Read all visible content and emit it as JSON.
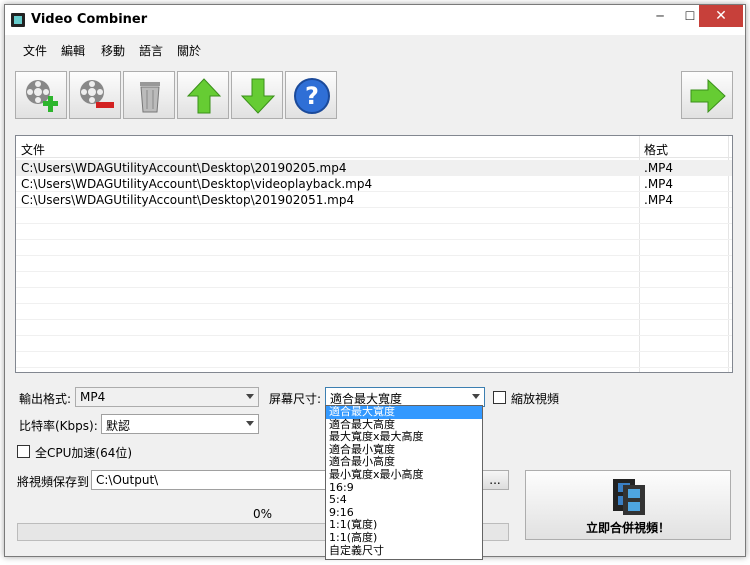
{
  "window": {
    "title": "Video Combiner",
    "min_glyph": "─",
    "max_glyph": "☐",
    "close_glyph": "✕"
  },
  "menu": [
    "文件",
    "編輯",
    "移動",
    "語言",
    "關於"
  ],
  "toolbar": {
    "buttons": [
      "add-video-icon",
      "remove-video-icon",
      "clear-trash-icon",
      "move-up-icon",
      "move-down-icon",
      "help-icon",
      "next-arrow-icon"
    ]
  },
  "list": {
    "headers": {
      "file": "文件",
      "format": "格式"
    },
    "rows": [
      {
        "file": "C:\\Users\\WDAGUtilityAccount\\Desktop\\20190205.mp4",
        "format": ".MP4"
      },
      {
        "file": "C:\\Users\\WDAGUtilityAccount\\Desktop\\videoplayback.mp4",
        "format": ".MP4"
      },
      {
        "file": "C:\\Users\\WDAGUtilityAccount\\Desktop\\201902051.mp4",
        "format": ".MP4"
      }
    ]
  },
  "settings": {
    "output_format_label": "輸出格式:",
    "output_format_value": "MP4",
    "bitrate_label": "比特率(Kbps):",
    "bitrate_value": "默認",
    "screen_size_label": "屏幕尺寸:",
    "screen_size_value": "適合最大寬度",
    "scale_video_label": "縮放視頻",
    "cpu_accel_label": "全CPU加速(64位)",
    "save_to_label": "將視頻保存到",
    "save_path": "C:\\Output\\",
    "browse_label": "..."
  },
  "screen_size_options": [
    "適合最大寬度",
    "適合最大高度",
    "最大寬度x最大高度",
    "適合最小寬度",
    "適合最小高度",
    "最小寬度x最小高度",
    "16:9",
    "5:4",
    "9:16",
    "1:1(寬度)",
    "1:1(高度)",
    "自定義尺寸"
  ],
  "progress": {
    "text": "0%",
    "value": 0
  },
  "combine_button": "立即合併視頻！"
}
